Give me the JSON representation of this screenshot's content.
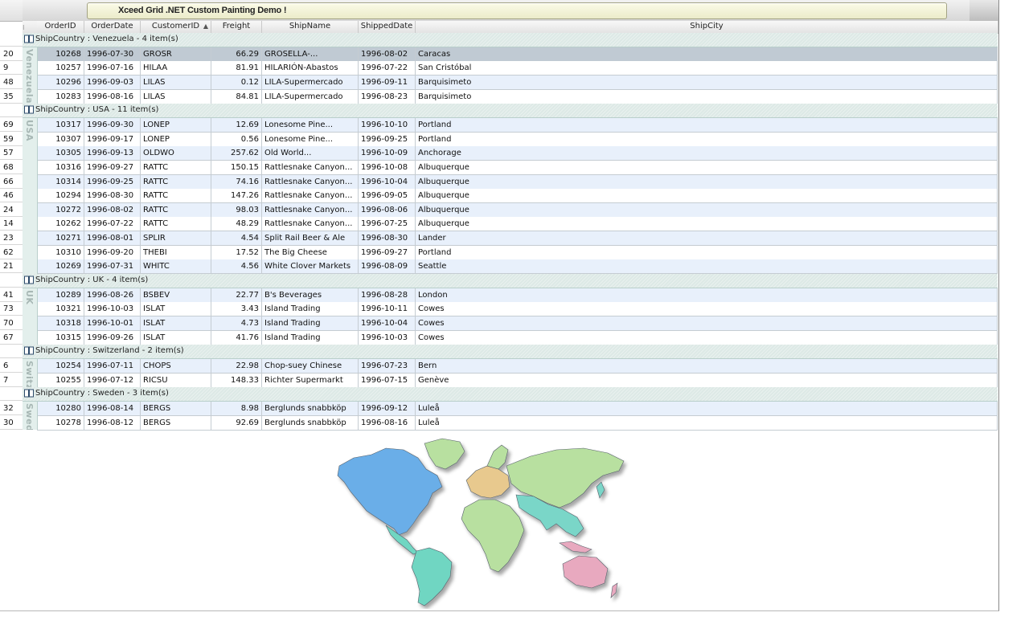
{
  "window": {
    "title": "Xceed Grid .NET Custom Painting Demo !"
  },
  "columns": [
    "OrderID",
    "OrderDate",
    "CustomerID",
    "Freight",
    "ShipName",
    "ShippedDate",
    "ShipCity"
  ],
  "sort_indicator": "▲",
  "groups": [
    {
      "label": "ShipCountry : Venezuela - 4 item(s)",
      "side_label": "Venezuela",
      "rows": [
        {
          "sel": "20",
          "cells": [
            "10268",
            "1996-07-30",
            "GROSR",
            "66.29",
            "GROSELLA-...",
            "1996-08-02",
            "Caracas"
          ],
          "selected": true
        },
        {
          "sel": "9",
          "cells": [
            "10257",
            "1996-07-16",
            "HILAA",
            "81.91",
            "HILARIÓN-Abastos",
            "1996-07-22",
            "San Cristóbal"
          ]
        },
        {
          "sel": "48",
          "cells": [
            "10296",
            "1996-09-03",
            "LILAS",
            "0.12",
            "LILA-Supermercado",
            "1996-09-11",
            "Barquisimeto"
          ]
        },
        {
          "sel": "35",
          "cells": [
            "10283",
            "1996-08-16",
            "LILAS",
            "84.81",
            "LILA-Supermercado",
            "1996-08-23",
            "Barquisimeto"
          ]
        }
      ]
    },
    {
      "label": "ShipCountry : USA - 11 item(s)",
      "side_label": "USA",
      "rows": [
        {
          "sel": "69",
          "cells": [
            "10317",
            "1996-09-30",
            "LONEP",
            "12.69",
            "Lonesome Pine...",
            "1996-10-10",
            "Portland"
          ]
        },
        {
          "sel": "59",
          "cells": [
            "10307",
            "1996-09-17",
            "LONEP",
            "0.56",
            "Lonesome Pine...",
            "1996-09-25",
            "Portland"
          ]
        },
        {
          "sel": "57",
          "cells": [
            "10305",
            "1996-09-13",
            "OLDWO",
            "257.62",
            "Old World...",
            "1996-10-09",
            "Anchorage"
          ]
        },
        {
          "sel": "68",
          "cells": [
            "10316",
            "1996-09-27",
            "RATTC",
            "150.15",
            "Rattlesnake Canyon...",
            "1996-10-08",
            "Albuquerque"
          ]
        },
        {
          "sel": "66",
          "cells": [
            "10314",
            "1996-09-25",
            "RATTC",
            "74.16",
            "Rattlesnake Canyon...",
            "1996-10-04",
            "Albuquerque"
          ]
        },
        {
          "sel": "46",
          "cells": [
            "10294",
            "1996-08-30",
            "RATTC",
            "147.26",
            "Rattlesnake Canyon...",
            "1996-09-05",
            "Albuquerque"
          ]
        },
        {
          "sel": "24",
          "cells": [
            "10272",
            "1996-08-02",
            "RATTC",
            "98.03",
            "Rattlesnake Canyon...",
            "1996-08-06",
            "Albuquerque"
          ]
        },
        {
          "sel": "14",
          "cells": [
            "10262",
            "1996-07-22",
            "RATTC",
            "48.29",
            "Rattlesnake Canyon...",
            "1996-07-25",
            "Albuquerque"
          ]
        },
        {
          "sel": "23",
          "cells": [
            "10271",
            "1996-08-01",
            "SPLIR",
            "4.54",
            "Split Rail Beer & Ale",
            "1996-08-30",
            "Lander"
          ]
        },
        {
          "sel": "62",
          "cells": [
            "10310",
            "1996-09-20",
            "THEBI",
            "17.52",
            "The Big Cheese",
            "1996-09-27",
            "Portland"
          ]
        },
        {
          "sel": "21",
          "cells": [
            "10269",
            "1996-07-31",
            "WHITC",
            "4.56",
            "White Clover Markets",
            "1996-08-09",
            "Seattle"
          ]
        }
      ]
    },
    {
      "label": "ShipCountry : UK - 4 item(s)",
      "side_label": "UK",
      "rows": [
        {
          "sel": "41",
          "cells": [
            "10289",
            "1996-08-26",
            "BSBEV",
            "22.77",
            "B's Beverages",
            "1996-08-28",
            "London"
          ]
        },
        {
          "sel": "73",
          "cells": [
            "10321",
            "1996-10-03",
            "ISLAT",
            "3.43",
            "Island Trading",
            "1996-10-11",
            "Cowes"
          ]
        },
        {
          "sel": "70",
          "cells": [
            "10318",
            "1996-10-01",
            "ISLAT",
            "4.73",
            "Island Trading",
            "1996-10-04",
            "Cowes"
          ]
        },
        {
          "sel": "67",
          "cells": [
            "10315",
            "1996-09-26",
            "ISLAT",
            "41.76",
            "Island Trading",
            "1996-10-03",
            "Cowes"
          ]
        }
      ]
    },
    {
      "label": "ShipCountry : Switzerland - 2 item(s)",
      "side_label": "Switz",
      "rows": [
        {
          "sel": "6",
          "cells": [
            "10254",
            "1996-07-11",
            "CHOPS",
            "22.98",
            "Chop-suey Chinese",
            "1996-07-23",
            "Bern"
          ]
        },
        {
          "sel": "7",
          "cells": [
            "10255",
            "1996-07-12",
            "RICSU",
            "148.33",
            "Richter Supermarkt",
            "1996-07-15",
            "Genève"
          ]
        }
      ]
    },
    {
      "label": "ShipCountry : Sweden - 3 item(s)",
      "side_label": "Swed",
      "rows": [
        {
          "sel": "32",
          "cells": [
            "10280",
            "1996-08-14",
            "BERGS",
            "8.98",
            "Berglunds snabbköp",
            "1996-09-12",
            "Luleå"
          ]
        },
        {
          "sel": "30",
          "cells": [
            "10278",
            "1996-08-12",
            "BERGS",
            "92.69",
            "Berglunds snabbköp",
            "1996-08-16",
            "Luleå"
          ]
        }
      ]
    }
  ],
  "colors": {
    "north_america": "#6aaee8",
    "south_america": "#6fd6c2",
    "europe": "#e8c98e",
    "africa_asia": "#b8e0a0",
    "asia_east": "#7ad6c8",
    "oceania": "#e8a9bf"
  }
}
